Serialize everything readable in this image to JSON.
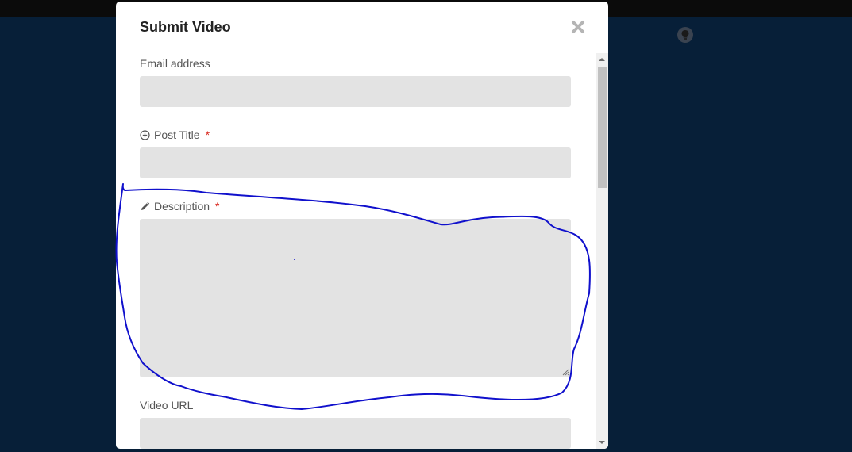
{
  "background": {
    "nav_text": "• •",
    "right_text": "•"
  },
  "modal": {
    "title": "Submit Video",
    "close_icon": "close-icon"
  },
  "form": {
    "email": {
      "label": "Email address",
      "value": ""
    },
    "post_title": {
      "label": "Post Title",
      "required_mark": "*",
      "icon": "plus-circle-icon",
      "value": ""
    },
    "description": {
      "label": "Description",
      "required_mark": "*",
      "icon": "pencil-icon",
      "value": ""
    },
    "video_url": {
      "label": "Video URL",
      "value": ""
    }
  },
  "colors": {
    "backdrop": "#071f38",
    "input_bg": "#e3e3e3",
    "required": "#d9261c",
    "annotation_stroke": "#1010cc"
  }
}
